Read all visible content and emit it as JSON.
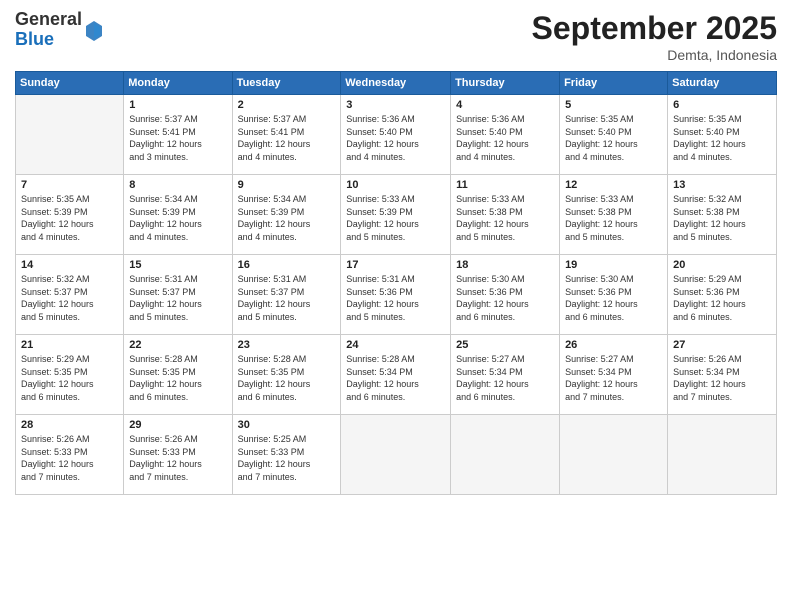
{
  "header": {
    "logo_general": "General",
    "logo_blue": "Blue",
    "month_title": "September 2025",
    "subtitle": "Demta, Indonesia"
  },
  "days_of_week": [
    "Sunday",
    "Monday",
    "Tuesday",
    "Wednesday",
    "Thursday",
    "Friday",
    "Saturday"
  ],
  "weeks": [
    [
      {
        "day": "",
        "info": ""
      },
      {
        "day": "1",
        "info": "Sunrise: 5:37 AM\nSunset: 5:41 PM\nDaylight: 12 hours\nand 3 minutes."
      },
      {
        "day": "2",
        "info": "Sunrise: 5:37 AM\nSunset: 5:41 PM\nDaylight: 12 hours\nand 4 minutes."
      },
      {
        "day": "3",
        "info": "Sunrise: 5:36 AM\nSunset: 5:40 PM\nDaylight: 12 hours\nand 4 minutes."
      },
      {
        "day": "4",
        "info": "Sunrise: 5:36 AM\nSunset: 5:40 PM\nDaylight: 12 hours\nand 4 minutes."
      },
      {
        "day": "5",
        "info": "Sunrise: 5:35 AM\nSunset: 5:40 PM\nDaylight: 12 hours\nand 4 minutes."
      },
      {
        "day": "6",
        "info": "Sunrise: 5:35 AM\nSunset: 5:40 PM\nDaylight: 12 hours\nand 4 minutes."
      }
    ],
    [
      {
        "day": "7",
        "info": "Sunrise: 5:35 AM\nSunset: 5:39 PM\nDaylight: 12 hours\nand 4 minutes."
      },
      {
        "day": "8",
        "info": "Sunrise: 5:34 AM\nSunset: 5:39 PM\nDaylight: 12 hours\nand 4 minutes."
      },
      {
        "day": "9",
        "info": "Sunrise: 5:34 AM\nSunset: 5:39 PM\nDaylight: 12 hours\nand 4 minutes."
      },
      {
        "day": "10",
        "info": "Sunrise: 5:33 AM\nSunset: 5:39 PM\nDaylight: 12 hours\nand 5 minutes."
      },
      {
        "day": "11",
        "info": "Sunrise: 5:33 AM\nSunset: 5:38 PM\nDaylight: 12 hours\nand 5 minutes."
      },
      {
        "day": "12",
        "info": "Sunrise: 5:33 AM\nSunset: 5:38 PM\nDaylight: 12 hours\nand 5 minutes."
      },
      {
        "day": "13",
        "info": "Sunrise: 5:32 AM\nSunset: 5:38 PM\nDaylight: 12 hours\nand 5 minutes."
      }
    ],
    [
      {
        "day": "14",
        "info": "Sunrise: 5:32 AM\nSunset: 5:37 PM\nDaylight: 12 hours\nand 5 minutes."
      },
      {
        "day": "15",
        "info": "Sunrise: 5:31 AM\nSunset: 5:37 PM\nDaylight: 12 hours\nand 5 minutes."
      },
      {
        "day": "16",
        "info": "Sunrise: 5:31 AM\nSunset: 5:37 PM\nDaylight: 12 hours\nand 5 minutes."
      },
      {
        "day": "17",
        "info": "Sunrise: 5:31 AM\nSunset: 5:36 PM\nDaylight: 12 hours\nand 5 minutes."
      },
      {
        "day": "18",
        "info": "Sunrise: 5:30 AM\nSunset: 5:36 PM\nDaylight: 12 hours\nand 6 minutes."
      },
      {
        "day": "19",
        "info": "Sunrise: 5:30 AM\nSunset: 5:36 PM\nDaylight: 12 hours\nand 6 minutes."
      },
      {
        "day": "20",
        "info": "Sunrise: 5:29 AM\nSunset: 5:36 PM\nDaylight: 12 hours\nand 6 minutes."
      }
    ],
    [
      {
        "day": "21",
        "info": "Sunrise: 5:29 AM\nSunset: 5:35 PM\nDaylight: 12 hours\nand 6 minutes."
      },
      {
        "day": "22",
        "info": "Sunrise: 5:28 AM\nSunset: 5:35 PM\nDaylight: 12 hours\nand 6 minutes."
      },
      {
        "day": "23",
        "info": "Sunrise: 5:28 AM\nSunset: 5:35 PM\nDaylight: 12 hours\nand 6 minutes."
      },
      {
        "day": "24",
        "info": "Sunrise: 5:28 AM\nSunset: 5:34 PM\nDaylight: 12 hours\nand 6 minutes."
      },
      {
        "day": "25",
        "info": "Sunrise: 5:27 AM\nSunset: 5:34 PM\nDaylight: 12 hours\nand 6 minutes."
      },
      {
        "day": "26",
        "info": "Sunrise: 5:27 AM\nSunset: 5:34 PM\nDaylight: 12 hours\nand 7 minutes."
      },
      {
        "day": "27",
        "info": "Sunrise: 5:26 AM\nSunset: 5:34 PM\nDaylight: 12 hours\nand 7 minutes."
      }
    ],
    [
      {
        "day": "28",
        "info": "Sunrise: 5:26 AM\nSunset: 5:33 PM\nDaylight: 12 hours\nand 7 minutes."
      },
      {
        "day": "29",
        "info": "Sunrise: 5:26 AM\nSunset: 5:33 PM\nDaylight: 12 hours\nand 7 minutes."
      },
      {
        "day": "30",
        "info": "Sunrise: 5:25 AM\nSunset: 5:33 PM\nDaylight: 12 hours\nand 7 minutes."
      },
      {
        "day": "",
        "info": ""
      },
      {
        "day": "",
        "info": ""
      },
      {
        "day": "",
        "info": ""
      },
      {
        "day": "",
        "info": ""
      }
    ]
  ]
}
